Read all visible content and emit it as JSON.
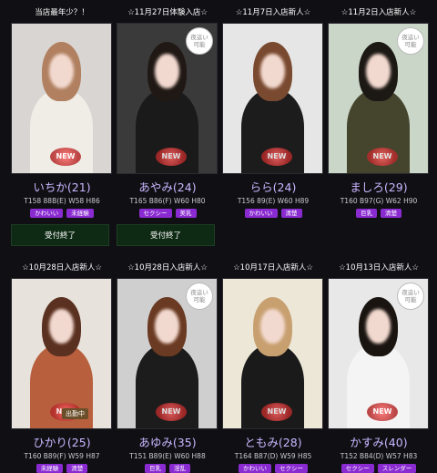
{
  "cards": [
    {
      "caption": "当店最年少？！",
      "name": "いちか(21)",
      "specs": "T158 88B(E) W58 H86",
      "tags": [
        "かわいい",
        "未経験"
      ],
      "badges": {
        "new": true,
        "night": false,
        "live": false
      },
      "button": "受付終了",
      "colors": {
        "bg": "#d9d5d2",
        "body": "#f0ece6",
        "hair": "#b08060"
      }
    },
    {
      "caption": "☆11月27日体験入店☆",
      "name": "あやみ(24)",
      "specs": "T165 B86(F) W60 H80",
      "tags": [
        "セクシー",
        "美乳"
      ],
      "badges": {
        "new": true,
        "night": true,
        "live": false
      },
      "button": "受付終了",
      "colors": {
        "bg": "#3a3a3a",
        "body": "#1a1a1a",
        "hair": "#201814"
      }
    },
    {
      "caption": "☆11月7日入店新人☆",
      "name": "らら(24)",
      "specs": "T156 89(E) W60 H89",
      "tags": [
        "かわいい",
        "清楚"
      ],
      "badges": {
        "new": true,
        "night": false,
        "live": false
      },
      "button": null,
      "colors": {
        "bg": "#e6e6e6",
        "body": "#1c1c1c",
        "hair": "#7a4a30"
      }
    },
    {
      "caption": "☆11月2日入店新人☆",
      "name": "ましろ(29)",
      "specs": "T160 B97(G) W62 H90",
      "tags": [
        "巨乳",
        "清楚"
      ],
      "badges": {
        "new": true,
        "night": true,
        "live": false
      },
      "button": null,
      "colors": {
        "bg": "#c9d6c8",
        "body": "#45452e",
        "hair": "#1c1814"
      }
    },
    {
      "caption": "☆10月28日入店新人☆",
      "name": "ひかり(25)",
      "specs": "T160 B89(F) W59 H87",
      "tags": [
        "未経験",
        "清楚"
      ],
      "badges": {
        "new": true,
        "night": false,
        "live": true,
        "live_label": "出勤中"
      },
      "button": null,
      "colors": {
        "bg": "#e8e2dc",
        "body": "#b8603e",
        "hair": "#5a3020"
      }
    },
    {
      "caption": "☆10月28日入店新人☆",
      "name": "あゆみ(35)",
      "specs": "T151 B89(E) W60 H88",
      "tags": [
        "巨乳",
        "淫乱"
      ],
      "badges": {
        "new": true,
        "night": true,
        "live": false
      },
      "button": null,
      "colors": {
        "bg": "#cfcfcf",
        "body": "#1c1c1c",
        "hair": "#6a3a22"
      }
    },
    {
      "caption": "☆10月17日入店新人☆",
      "name": "ともみ(28)",
      "specs": "T164 B87(D) W59 H85",
      "tags": [
        "かわいい",
        "セクシー"
      ],
      "badges": {
        "new": true,
        "night": false,
        "live": false
      },
      "button": null,
      "colors": {
        "bg": "#ece7d6",
        "body": "#1a1a1a",
        "hair": "#c8a070"
      }
    },
    {
      "caption": "☆10月13日入店新人☆",
      "name": "かすみ(40)",
      "specs": "T152 B84(D) W57 H83",
      "tags": [
        "セクシー",
        "スレンダー"
      ],
      "badges": {
        "new": true,
        "night": true,
        "live": false
      },
      "button": null,
      "colors": {
        "bg": "#e8e8e8",
        "body": "#f4f4f4",
        "hair": "#1a1410"
      }
    }
  ],
  "labels": {
    "new": "NEW",
    "night": "夜這い可能"
  }
}
